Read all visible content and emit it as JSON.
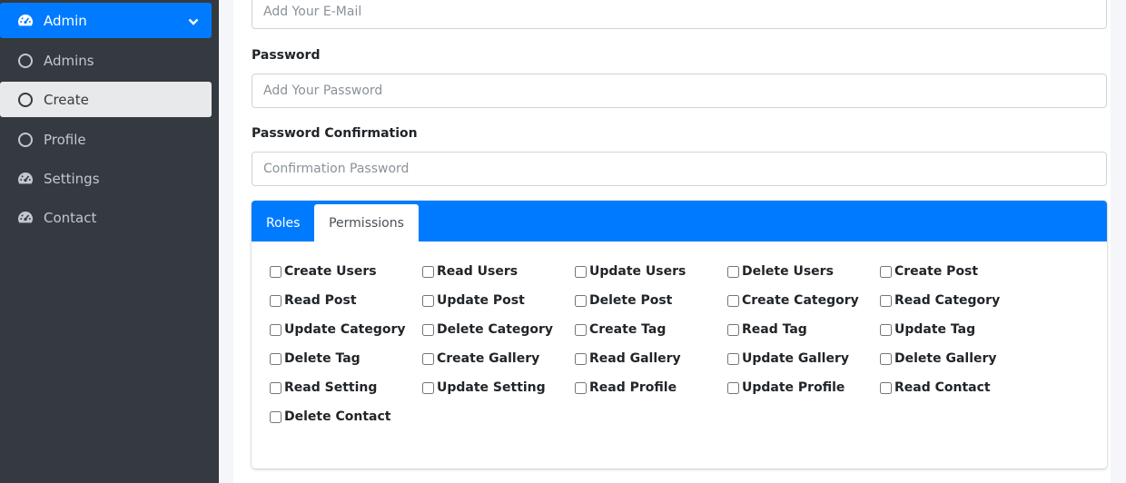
{
  "sidebar": {
    "items": [
      {
        "label": "Admin",
        "icon": "tachometer-icon",
        "state": "active-parent"
      },
      {
        "label": "Admins",
        "icon": "circle-icon"
      },
      {
        "label": "Create",
        "icon": "circle-icon",
        "state": "active-child"
      },
      {
        "label": "Profile",
        "icon": "circle-icon"
      },
      {
        "label": "Settings",
        "icon": "tachometer-icon"
      },
      {
        "label": "Contact",
        "icon": "tachometer-icon"
      }
    ]
  },
  "form": {
    "email": {
      "placeholder": "Add Your E-Mail"
    },
    "password": {
      "label": "Password",
      "placeholder": "Add Your Password"
    },
    "password_confirmation": {
      "label": "Password Confirmation",
      "placeholder": "Confirmation Password"
    }
  },
  "tabs": {
    "roles": "Roles",
    "permissions": "Permissions",
    "active": "Permissions"
  },
  "permissions": [
    "Create Users",
    "Read Users",
    "Update Users",
    "Delete Users",
    "Create Post",
    "Read Post",
    "Update Post",
    "Delete Post",
    "Create Category",
    "Read Category",
    "Update Category",
    "Delete Category",
    "Create Tag",
    "Read Tag",
    "Update Tag",
    "Delete Tag",
    "Create Gallery",
    "Read Gallery",
    "Update Gallery",
    "Delete Gallery",
    "Read Setting",
    "Update Setting",
    "Read Profile",
    "Update Profile",
    "Read Contact",
    "Delete Contact"
  ],
  "colors": {
    "accent": "#007bff",
    "sidebar_bg": "#343a40",
    "sidebar_text": "#c2c7d0",
    "active_child_bg": "#e8e9ea"
  }
}
